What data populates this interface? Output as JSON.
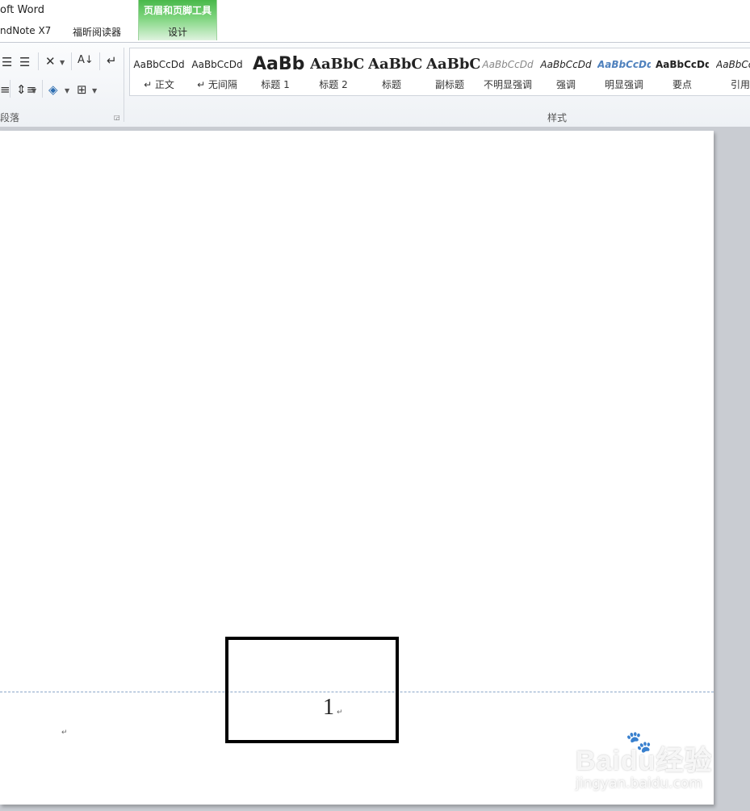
{
  "titlebar": {
    "word_title": "oft Word",
    "endnote_tab": "ndNote X7",
    "foxit_tab": "福昕阅读器",
    "contextual_group": "页眉和页脚工具",
    "design_tab": "设计"
  },
  "ribbon": {
    "paragraph_group": {
      "label": "段落"
    },
    "styles_group": {
      "label": "样式",
      "items": [
        {
          "sample": "AaBbCcDd",
          "name": "↵ 正文"
        },
        {
          "sample": "AaBbCcDd",
          "name": "↵ 无间隔"
        },
        {
          "sample": "AaBb",
          "name": "标题 1"
        },
        {
          "sample": "AaBbC",
          "name": "标题 2"
        },
        {
          "sample": "AaBbC",
          "name": "标题"
        },
        {
          "sample": "AaBbC",
          "name": "副标题"
        },
        {
          "sample": "AaBbCcDd",
          "name": "不明显强调"
        },
        {
          "sample": "AaBbCcDd",
          "name": "强调"
        },
        {
          "sample": "AaBbCcDd",
          "name": "明显强调"
        },
        {
          "sample": "AaBbCcDd",
          "name": "要点"
        },
        {
          "sample": "AaBbCc",
          "name": "引用"
        }
      ]
    },
    "icons": {
      "decrease_indent": "decrease-indent-icon",
      "increase_indent": "increase-indent-icon",
      "chinese_layout": "chinese-layout-icon",
      "sort": "sort-icon",
      "show_marks": "show-marks-icon",
      "align": "align-icon",
      "line_spacing": "line-spacing-icon",
      "shading": "shading-icon",
      "borders": "borders-icon"
    }
  },
  "document": {
    "page_number": "1",
    "paragraph_mark": "↵"
  },
  "watermark": {
    "logo": "Baidu经验",
    "url": "jingyan.baidu.com"
  },
  "colors": {
    "contextual_green": "#49b84a",
    "emphasis_blue": "#4f81bd",
    "page_bg": "#ffffff",
    "workspace_bg": "#c9ccd2"
  }
}
